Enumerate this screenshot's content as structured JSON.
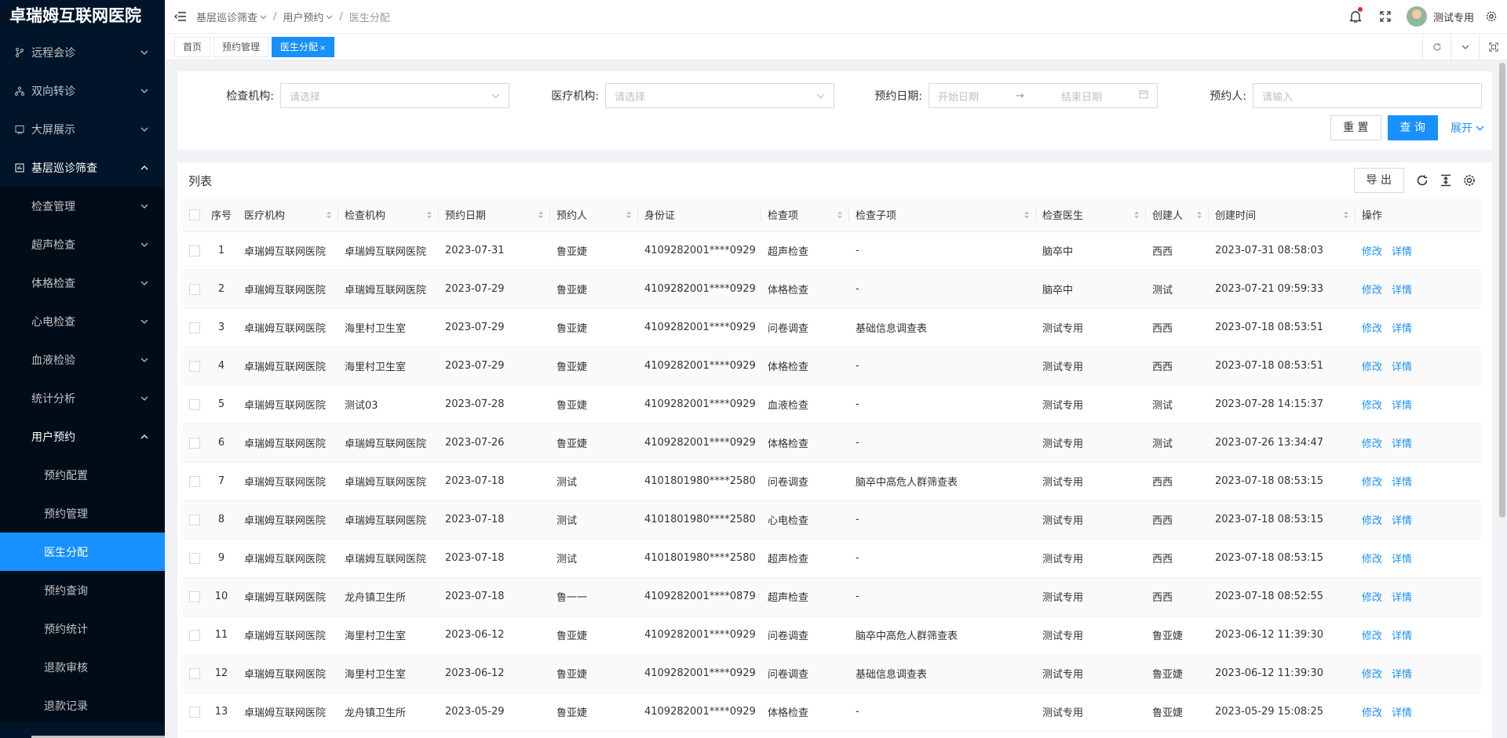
{
  "brand": "卓瑞姆互联网医院",
  "sidebar": {
    "items": [
      {
        "label": "远程会诊",
        "icon": "branch-icon"
      },
      {
        "label": "双向转诊",
        "icon": "network-icon"
      },
      {
        "label": "大屏展示",
        "icon": "screen-icon"
      },
      {
        "label": "基层巡诊筛查",
        "icon": "chart-box-icon"
      }
    ],
    "sub": [
      "检查管理",
      "超声检查",
      "体格检查",
      "心电检查",
      "血液检验",
      "统计分析",
      "用户预约"
    ],
    "subsub": [
      "预约配置",
      "预约管理",
      "医生分配",
      "预约查询",
      "预约统计",
      "退款审核",
      "退款记录"
    ]
  },
  "header": {
    "crumbs": [
      "基层巡诊筛查",
      "用户预约",
      "医生分配"
    ],
    "user": "测试专用"
  },
  "tabs": [
    {
      "label": "首页"
    },
    {
      "label": "预约管理"
    },
    {
      "label": "医生分配",
      "close": "×"
    }
  ],
  "filters": {
    "exam_org_label": "检查机构:",
    "exam_org_placeholder": "请选择",
    "med_org_label": "医疗机构:",
    "med_org_placeholder": "请选择",
    "date_label": "预约日期:",
    "date_start": "开始日期",
    "date_arrow": "→",
    "date_end": "结束日期",
    "person_label": "预约人:",
    "person_placeholder": "请输入",
    "reset": "重 置",
    "query": "查 询",
    "expand": "展开"
  },
  "list": {
    "title": "列表",
    "export": "导 出",
    "columns": [
      "序号",
      "医疗机构",
      "检查机构",
      "预约日期",
      "预约人",
      "身份证",
      "检查项",
      "检查子项",
      "检查医生",
      "创建人",
      "创建时间",
      "操作"
    ],
    "action_edit": "修改",
    "action_detail": "详情",
    "rows": [
      [
        "1",
        "卓瑞姆互联网医院",
        "卓瑞姆互联网医院",
        "2023-07-31",
        "鲁亚婕",
        "4109282001****0929",
        "超声检查",
        "-",
        "脑卒中",
        "西西",
        "2023-07-31 08:58:03"
      ],
      [
        "2",
        "卓瑞姆互联网医院",
        "卓瑞姆互联网医院",
        "2023-07-29",
        "鲁亚婕",
        "4109282001****0929",
        "体格检查",
        "-",
        "脑卒中",
        "测试",
        "2023-07-21 09:59:33"
      ],
      [
        "3",
        "卓瑞姆互联网医院",
        "海里村卫生室",
        "2023-07-29",
        "鲁亚婕",
        "4109282001****0929",
        "问卷调查",
        "基础信息调查表",
        "测试专用",
        "西西",
        "2023-07-18 08:53:51"
      ],
      [
        "4",
        "卓瑞姆互联网医院",
        "海里村卫生室",
        "2023-07-29",
        "鲁亚婕",
        "4109282001****0929",
        "体格检查",
        "-",
        "测试专用",
        "西西",
        "2023-07-18 08:53:51"
      ],
      [
        "5",
        "卓瑞姆互联网医院",
        "测试03",
        "2023-07-28",
        "鲁亚婕",
        "4109282001****0929",
        "血液检查",
        "-",
        "测试专用",
        "测试",
        "2023-07-28 14:15:37"
      ],
      [
        "6",
        "卓瑞姆互联网医院",
        "卓瑞姆互联网医院",
        "2023-07-26",
        "鲁亚婕",
        "4109282001****0929",
        "体格检查",
        "-",
        "测试专用",
        "测试",
        "2023-07-26 13:34:47"
      ],
      [
        "7",
        "卓瑞姆互联网医院",
        "卓瑞姆互联网医院",
        "2023-07-18",
        "测试",
        "4101801980****2580",
        "问卷调查",
        "脑卒中高危人群筛查表",
        "测试专用",
        "西西",
        "2023-07-18 08:53:15"
      ],
      [
        "8",
        "卓瑞姆互联网医院",
        "卓瑞姆互联网医院",
        "2023-07-18",
        "测试",
        "4101801980****2580",
        "心电检查",
        "-",
        "测试专用",
        "西西",
        "2023-07-18 08:53:15"
      ],
      [
        "9",
        "卓瑞姆互联网医院",
        "卓瑞姆互联网医院",
        "2023-07-18",
        "测试",
        "4101801980****2580",
        "超声检查",
        "-",
        "测试专用",
        "西西",
        "2023-07-18 08:53:15"
      ],
      [
        "10",
        "卓瑞姆互联网医院",
        "龙舟镇卫生所",
        "2023-07-18",
        "鲁一一",
        "4109282001****0879",
        "超声检查",
        "-",
        "测试专用",
        "西西",
        "2023-07-18 08:52:55"
      ],
      [
        "11",
        "卓瑞姆互联网医院",
        "海里村卫生室",
        "2023-06-12",
        "鲁亚婕",
        "4109282001****0929",
        "问卷调查",
        "脑卒中高危人群筛查表",
        "测试专用",
        "鲁亚婕",
        "2023-06-12 11:39:30"
      ],
      [
        "12",
        "卓瑞姆互联网医院",
        "海里村卫生室",
        "2023-06-12",
        "鲁亚婕",
        "4109282001****0929",
        "问卷调查",
        "基础信息调查表",
        "测试专用",
        "鲁亚婕",
        "2023-06-12 11:39:30"
      ],
      [
        "13",
        "卓瑞姆互联网医院",
        "龙舟镇卫生所",
        "2023-05-29",
        "鲁亚婕",
        "4109282001****0929",
        "体格检查",
        "-",
        "测试专用",
        "鲁亚婕",
        "2023-05-29 15:08:25"
      ]
    ]
  },
  "colors": {
    "accent": "#1890ff",
    "sidebar_bg": "#001529",
    "submenu_bg": "#000c17"
  }
}
